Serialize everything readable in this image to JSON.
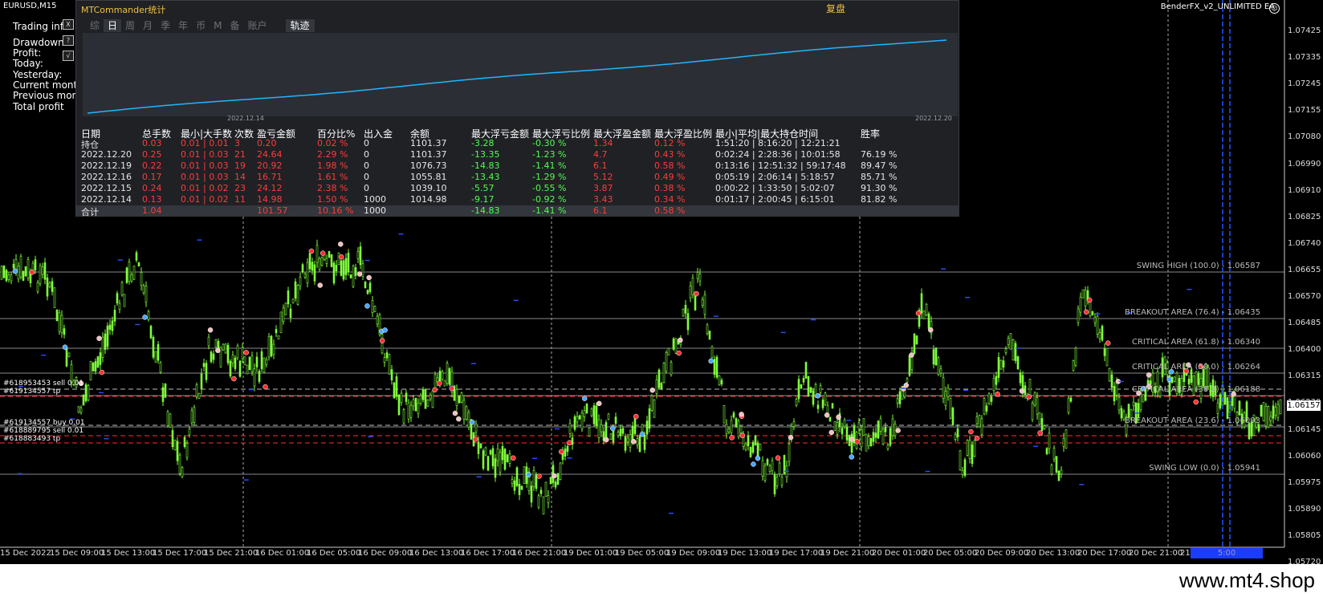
{
  "symbol": "EURUSD,M15",
  "ea_name": "BenderFX_v2_UNLIMITED EA",
  "info_labels": [
    "Trading info",
    "Drawdown:",
    "Profit:",
    "Today:",
    "Yesterday:",
    "Current month",
    "Previous month",
    "Total profit"
  ],
  "side_buttons": [
    "X",
    "?",
    "√"
  ],
  "panel": {
    "title": "MTCommander统计",
    "replay_button": "复盘",
    "tabs": [
      "综",
      "日",
      "周",
      "月",
      "季",
      "年",
      "币",
      "M",
      "备",
      "账户"
    ],
    "active_tab": "日",
    "track_tab": "轨迹",
    "eq_start_date": "2022.12.14",
    "eq_end_date": "2022.12.20",
    "headers": [
      "日期",
      "总手数",
      "最小|大手数",
      "次数",
      "盈亏金额",
      "百分比%",
      "出入金",
      "余额",
      "最大浮亏金额",
      "最大浮亏比例",
      "最大浮盈金额",
      "最大浮盈比例",
      "最小|平均|最大持仓时间",
      "胜率"
    ],
    "rows": [
      [
        "持仓",
        "0.03",
        "0.01 | 0.01",
        "3",
        "0.20",
        "0.02 %",
        "0",
        "1101.37",
        "-3.28",
        "-0.30 %",
        "1.34",
        "0.12 %",
        "1:51:20 | 8:16:20 | 12:21:21",
        ""
      ],
      [
        "2022.12.20",
        "0.25",
        "0.01 | 0.03",
        "21",
        "24.64",
        "2.29 %",
        "0",
        "1101.37",
        "-13.35",
        "-1.23 %",
        "4.7",
        "0.43 %",
        "0:02:24 | 2:28:36 | 10:01:58",
        "76.19 %"
      ],
      [
        "2022.12.19",
        "0.22",
        "0.01 | 0.03",
        "19",
        "20.92",
        "1.98 %",
        "0",
        "1076.73",
        "-14.83",
        "-1.41 %",
        "6.1",
        "0.58 %",
        "0:13:16 | 12:51:32 | 59:17:48",
        "89.47 %"
      ],
      [
        "2022.12.16",
        "0.17",
        "0.01 | 0.03",
        "14",
        "16.71",
        "1.61 %",
        "0",
        "1055.81",
        "-13.43",
        "-1.29 %",
        "5.12",
        "0.49 %",
        "0:05:19 | 2:06:14 | 5:18:57",
        "85.71 %"
      ],
      [
        "2022.12.15",
        "0.24",
        "0.01 | 0.02",
        "23",
        "24.12",
        "2.38 %",
        "0",
        "1039.10",
        "-5.57",
        "-0.55 %",
        "3.87",
        "0.38 %",
        "0:00:22 | 1:33:50 | 5:02:07",
        "91.30 %"
      ],
      [
        "2022.12.14",
        "0.13",
        "0.01 | 0.02",
        "11",
        "14.98",
        "1.50 %",
        "1000",
        "1014.98",
        "-9.17",
        "-0.92 %",
        "3.43",
        "0.34 %",
        "0:01:17 | 2:00:45 | 6:15:01",
        "81.82 %"
      ]
    ],
    "total": [
      "合计",
      "1.04",
      "",
      "",
      "101.57",
      "10.16 %",
      "1000",
      "",
      "-14.83",
      "-1.41 %",
      "6.1",
      "0.58 %",
      "",
      ""
    ]
  },
  "price_axis": [
    "1.07425",
    "1.07335",
    "1.07245",
    "1.07155",
    "1.07080",
    "1.06990",
    "1.06910",
    "1.06825",
    "1.06740",
    "1.06655",
    "1.06570",
    "1.06485",
    "1.06400",
    "1.06315",
    "1.06230",
    "1.06145",
    "1.06060",
    "1.05975",
    "1.05890",
    "1.05805",
    "1.05720"
  ],
  "current_price": "1.06157",
  "time_axis": [
    "15 Dec 2022",
    "15 Dec 09:00",
    "15 Dec 13:00",
    "15 Dec 17:00",
    "15 Dec 21:00",
    "16 Dec 01:00",
    "16 Dec 05:00",
    "16 Dec 09:00",
    "16 Dec 13:00",
    "16 Dec 17:00",
    "16 Dec 21:00",
    "19 Dec 01:00",
    "19 Dec 05:00",
    "19 Dec 09:00",
    "19 Dec 13:00",
    "19 Dec 17:00",
    "19 Dec 21:00",
    "20 Dec 01:00",
    "20 Dec 05:00",
    "20 Dec 09:00",
    "20 Dec 13:00",
    "20 Dec 17:00",
    "20 Dec 21:00",
    "21"
  ],
  "time_axis_end": "5:00",
  "fibo_levels": [
    "SWING HIGH (100.0) - 1.06587",
    "BREAKOUT AREA (76.4) - 1.06435",
    "CRITICAL AREA (61.8) - 1.06340",
    "CRITICAL AREA (50.0) - 1.06264",
    "CRITICAL AREA (38.2) - 1.06188",
    "BREAKOUT AREA (23.6) - 1.06093",
    "SWING LOW (0.0) - 1.05941"
  ],
  "orders": [
    "#618953453 sell 0.01",
    "#619134557 tp",
    "#619134557 buy 0.01",
    "#618889795 sell 0.01",
    "#618883493 tp"
  ],
  "watermark": "www.mt4.shop",
  "colors": {
    "candle": "#7fff3a",
    "equity_line": "#1fb6ff",
    "panel_bg": "#1f2125",
    "title": "#f0c040",
    "loss": "#ff3b3b",
    "gain": "#4dff4d"
  }
}
